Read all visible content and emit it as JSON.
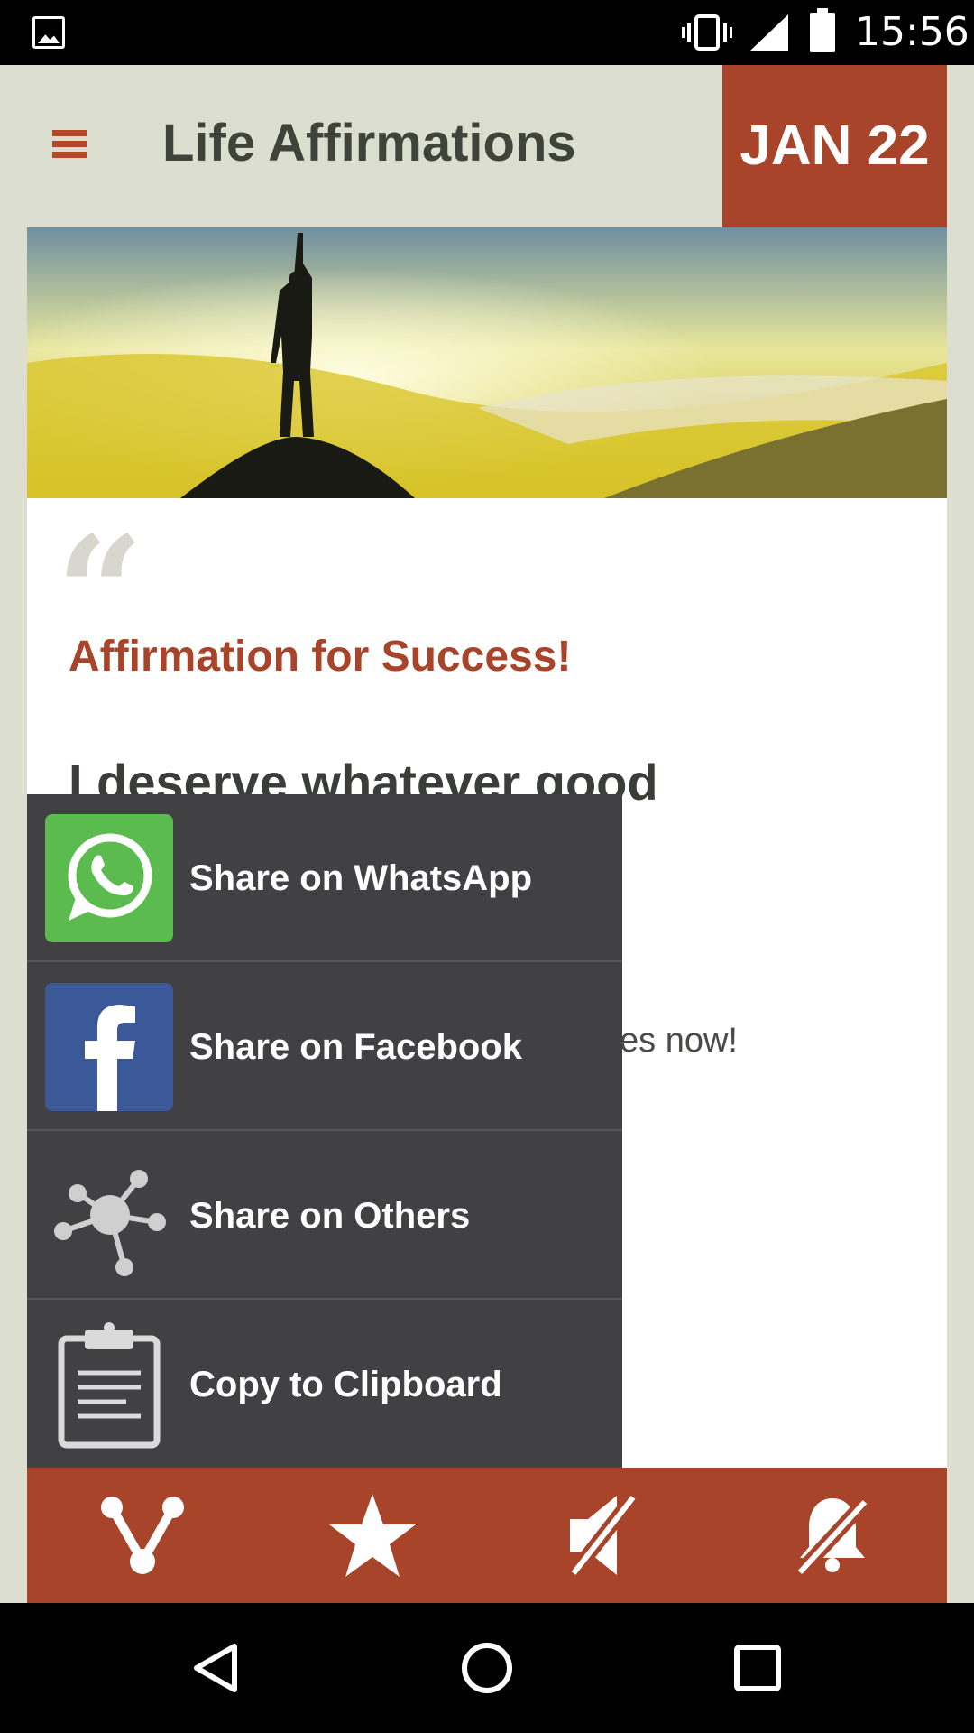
{
  "status_bar": {
    "time": "15:56"
  },
  "app_bar": {
    "title": "Life Affirmations",
    "date": "JAN 22"
  },
  "affirmation": {
    "quote_mark": "“",
    "title": "Affirmation for Success!",
    "text": "I deserve whatever good",
    "favorites_line": "ites now!"
  },
  "share_menu": {
    "items": [
      {
        "label": "Share on WhatsApp",
        "icon": "whatsapp-icon"
      },
      {
        "label": "Share on Facebook",
        "icon": "facebook-icon"
      },
      {
        "label": "Share on Others",
        "icon": "share-network-icon"
      },
      {
        "label": "Copy to Clipboard",
        "icon": "clipboard-icon"
      }
    ]
  },
  "action_bar": {
    "icons": [
      "share-icon",
      "star-icon",
      "sound-muted-icon",
      "notifications-off-icon"
    ]
  },
  "nav_bar": {
    "icons": [
      "back-icon",
      "home-icon",
      "recents-icon"
    ]
  },
  "colors": {
    "accent": "#a8442a",
    "background": "#dcdfcf",
    "menu_background": "#414042",
    "whatsapp_green": "#5cbb4f",
    "facebook_blue": "#3b5998"
  }
}
